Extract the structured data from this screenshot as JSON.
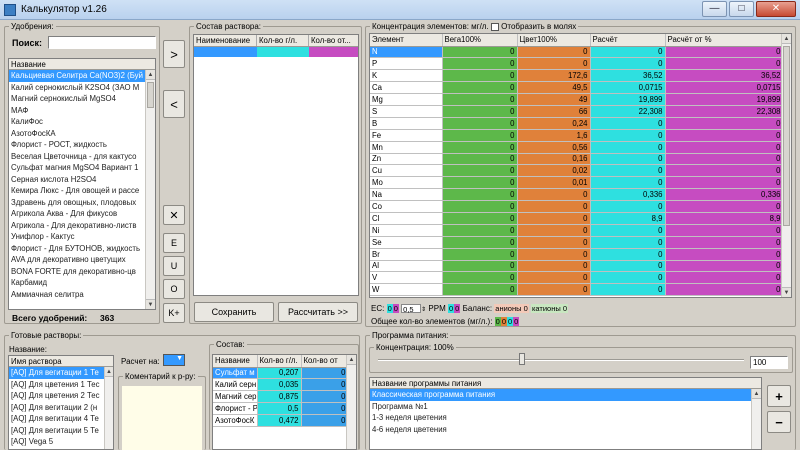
{
  "window": {
    "title": "Калькулятор v1.26",
    "minimize": "—",
    "maximize": "□",
    "close": "✕"
  },
  "fertilizers": {
    "legend": "Удобрения:",
    "search_label": "Поиск:",
    "search_value": "",
    "header": "Название",
    "items": [
      "Кальциевая Селитра Ca(NO3)2 (Буй",
      "Калий сернокислый K2SO4 (ЗАО М",
      "Магний сернокислый MgSO4",
      "МАФ",
      "КалиФос",
      "АзотоФосКА",
      "Флорист - РОСТ, жидкость",
      "Веселая Цветочница - для кактусо",
      "Сульфат магния MgSO4 Вариант 1",
      "Серная кислота H2SO4",
      "Кемира Люкс - Для овощей и рассе",
      "Здравень для овощных, плодовых",
      "Агрикола Аква - Для фикусов",
      "Агрикола - Для декоративно-листв",
      "Унифлор - Кактус",
      "Флорист - Для БУТОНОВ, жидкость",
      "AVA для декоративно цветущих",
      "BONA FORTE для декоративно-цв",
      "Карбамид",
      "Аммиачная селитра"
    ],
    "total_label": "Всего удобрений:",
    "total_value": "363"
  },
  "transfer_buttons": {
    "add": ">",
    "remove": "<",
    "clear": "✕",
    "e": "E",
    "u": "U",
    "o": "O",
    "kplus": "K+"
  },
  "solution": {
    "legend": "Состав раствора:",
    "columns": [
      "Наименование",
      "Кол-во г/л.",
      "Кол-во от..."
    ],
    "save": "Сохранить",
    "calculate": "Рассчитать >>"
  },
  "concentration": {
    "legend": "Концентрация элементов: мг/л.",
    "moles_label": "Отобразить в молях",
    "columns": [
      "Элемент",
      "Вега100%",
      "Цвет100%",
      "Расчёт",
      "Расчёт от %"
    ],
    "rows": [
      [
        "N",
        "0",
        "0",
        "0",
        "0"
      ],
      [
        "P",
        "0",
        "0",
        "0",
        "0"
      ],
      [
        "K",
        "0",
        "172,6",
        "36,52",
        "36,52"
      ],
      [
        "Ca",
        "0",
        "49,5",
        "0,0715",
        "0,0715"
      ],
      [
        "Mg",
        "0",
        "49",
        "19,899",
        "19,899"
      ],
      [
        "S",
        "0",
        "66",
        "22,308",
        "22,308"
      ],
      [
        "B",
        "0",
        "0,24",
        "0",
        "0"
      ],
      [
        "Fe",
        "0",
        "1,6",
        "0",
        "0"
      ],
      [
        "Mn",
        "0",
        "0,56",
        "0",
        "0"
      ],
      [
        "Zn",
        "0",
        "0,16",
        "0",
        "0"
      ],
      [
        "Cu",
        "0",
        "0,02",
        "0",
        "0"
      ],
      [
        "Mo",
        "0",
        "0,01",
        "0",
        "0"
      ],
      [
        "Na",
        "0",
        "0",
        "0,336",
        "0,336"
      ],
      [
        "Co",
        "0",
        "0",
        "0",
        "0"
      ],
      [
        "Cl",
        "0",
        "0",
        "8,9",
        "8,9"
      ],
      [
        "Ni",
        "0",
        "0",
        "0",
        "0"
      ],
      [
        "Se",
        "0",
        "0",
        "0",
        "0"
      ],
      [
        "Br",
        "0",
        "0",
        "0",
        "0"
      ],
      [
        "Al",
        "0",
        "0",
        "0",
        "0"
      ],
      [
        "V",
        "0",
        "0",
        "0",
        "0"
      ],
      [
        "W",
        "0",
        "0",
        "0",
        "0"
      ]
    ],
    "ec_label": "EC:",
    "ec_values": [
      "0",
      "0"
    ],
    "ec_input": "0,5",
    "ppm_label": "PPM",
    "ppm_values": [
      "0",
      "0"
    ],
    "balance_label": "Баланс:",
    "anions_label": "анионы 0",
    "cations_label": "катионы 0",
    "total_label": "Общее кол-во элементов (мг/л.):",
    "total_values": [
      "0",
      "0",
      "0",
      "0"
    ]
  },
  "ready": {
    "legend": "Готовые растворы:",
    "name_label": "Название:",
    "header": "Имя раствора",
    "items": [
      "[AQ] Для вегитации 1 Те",
      "[AQ] Для цветения 1 Тес",
      "[AQ] Для цветения 2 Тес",
      "[AQ] Для вегитации 2 (н",
      "[AQ] Для вегитации 4 Те",
      "[AQ] Для вегитации 5 Те",
      "[AQ] Vega 5"
    ],
    "calc_label": "Расчет на:",
    "calc_value": "",
    "comment_label": "Коментарий к р-ру:",
    "composition_label": "Состав:",
    "composition_columns": [
      "Название",
      "Кол-во г/л.",
      "Кол-во от"
    ],
    "composition_rows": [
      [
        "Сульфат м",
        "0,207",
        "0"
      ],
      [
        "Калий серн",
        "0,035",
        "0"
      ],
      [
        "Магний серн",
        "0,875",
        "0"
      ],
      [
        "Флорист - Р",
        "0,5",
        "0"
      ],
      [
        "АзотоФосК",
        "0,472",
        "0"
      ]
    ]
  },
  "program": {
    "legend": "Программа питания:",
    "conc_label": "Концентрация: 100%",
    "conc_value": "100",
    "header": "Название программы питания",
    "items": [
      "Классическая программа питания",
      "Программа №1",
      "1-3 неделя цветения",
      "4-6 неделя цветения"
    ],
    "plus": "+",
    "minus": "−"
  },
  "colors": {
    "selection": "#3399ff",
    "green": "#5db84a",
    "orange": "#e0813a",
    "cyan": "#2ee0e0",
    "magenta": "#c64cc1"
  }
}
